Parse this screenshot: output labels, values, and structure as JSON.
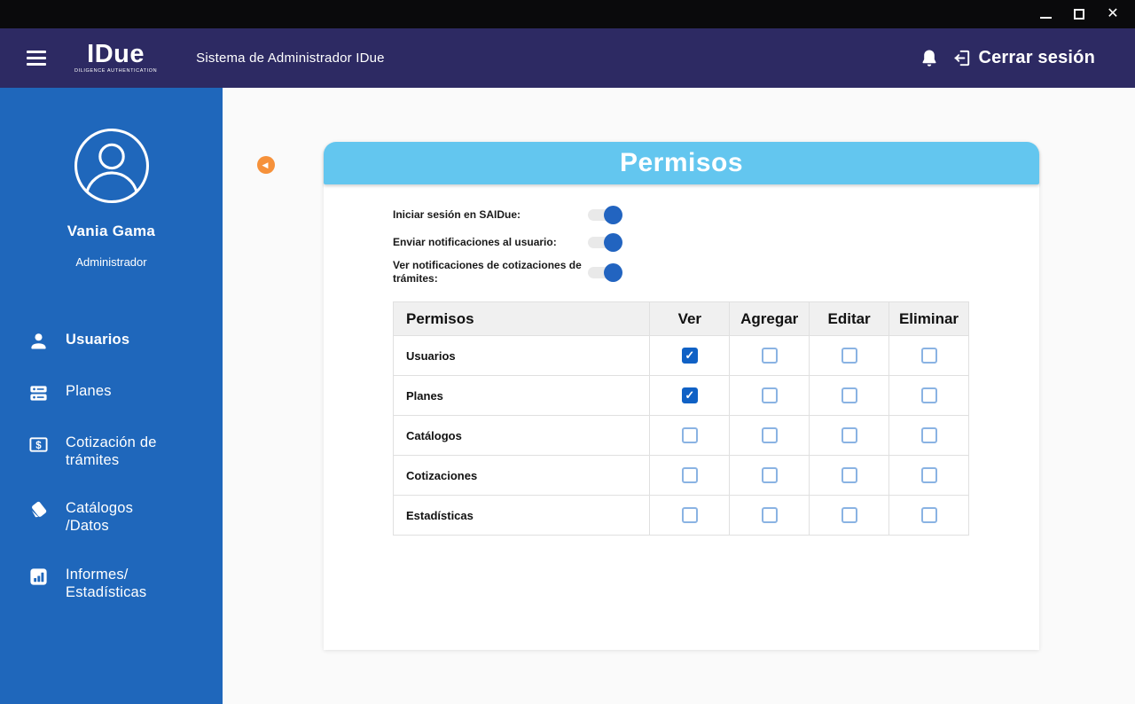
{
  "window": {
    "controls": [
      {
        "name": "minimize"
      },
      {
        "name": "maximize"
      },
      {
        "name": "close"
      }
    ]
  },
  "header": {
    "logo_text": "IDue",
    "logo_subtext": "DILIGENCE AUTHENTICATION",
    "app_title": "Sistema de Administrador IDue",
    "logout_label": "Cerrar sesión"
  },
  "sidebar": {
    "user_name": "Vania Gama",
    "user_role": "Administrador",
    "items": [
      {
        "label": "Usuarios",
        "icon": "user-icon",
        "active": true
      },
      {
        "label": "Planes",
        "icon": "plans-icon",
        "active": false
      },
      {
        "label": "Cotización de trámites",
        "icon": "quote-money-icon",
        "active": false
      },
      {
        "label": "Catálogos /Datos",
        "icon": "catalog-icon",
        "active": false
      },
      {
        "label": "Informes/ Estadísticas",
        "icon": "bar-chart-icon",
        "active": false
      }
    ]
  },
  "main": {
    "panel_title": "Permisos",
    "toggles": [
      {
        "label": "Iniciar sesión en SAIDue:",
        "on": true
      },
      {
        "label": "Enviar notificaciones al usuario:",
        "on": true
      },
      {
        "label": "Ver notificaciones de cotizaciones de trámites:",
        "on": true
      }
    ],
    "table": {
      "headers": [
        "Permisos",
        "Ver",
        "Agregar",
        "Editar",
        "Eliminar"
      ],
      "rows": [
        {
          "name": "Usuarios",
          "cells": [
            true,
            false,
            false,
            false
          ]
        },
        {
          "name": "Planes",
          "cells": [
            true,
            false,
            false,
            false
          ]
        },
        {
          "name": "Catálogos",
          "cells": [
            false,
            false,
            false,
            false
          ]
        },
        {
          "name": "Cotizaciones",
          "cells": [
            false,
            false,
            false,
            false
          ]
        },
        {
          "name": "Estadísticas",
          "cells": [
            false,
            false,
            false,
            false
          ]
        }
      ]
    }
  },
  "colors": {
    "titlebar": "#0a0a0c",
    "header_bar": "#2d2a63",
    "sidebar": "#1f67bb",
    "panel_header": "#63c6ef",
    "accent_orange": "#f6913a",
    "toggle_on": "#2264c0",
    "checkbox_checked": "#1061c5",
    "content_bg": "#fafafa"
  }
}
